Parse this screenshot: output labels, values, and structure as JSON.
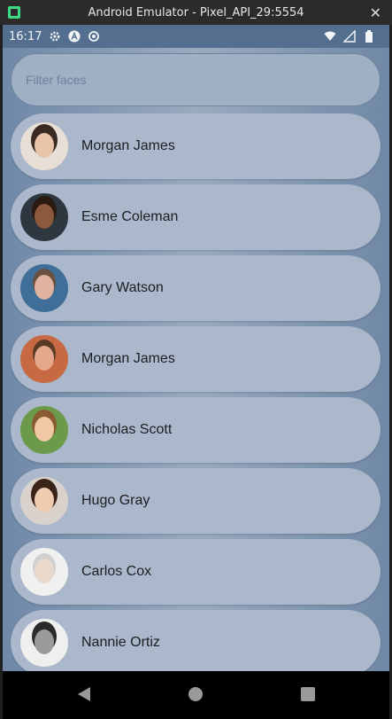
{
  "window": {
    "title": "Android Emulator - Pixel_API_29:5554",
    "close_label": "✕"
  },
  "statusbar": {
    "time": "16:17",
    "icons": [
      "gear-icon",
      "a-circle-icon",
      "sync-icon"
    ],
    "right_icons": [
      "wifi-icon",
      "signal-icon",
      "battery-icon"
    ]
  },
  "search": {
    "placeholder": "Filter faces"
  },
  "faces": [
    {
      "name": "Morgan James",
      "avatar_bg": "#e7dfd6",
      "face_color": "#e9c2aa",
      "hair_color": "#3a2a22"
    },
    {
      "name": "Esme Coleman",
      "avatar_bg": "#2e3640",
      "face_color": "#8b5a3c",
      "hair_color": "#2a1a12"
    },
    {
      "name": "Gary Watson",
      "avatar_bg": "#3f6f98",
      "face_color": "#e0b3a0",
      "hair_color": "#6a5040"
    },
    {
      "name": "Morgan James",
      "avatar_bg": "#c76a44",
      "face_color": "#e4a98a",
      "hair_color": "#5a3a22"
    },
    {
      "name": "Nicholas Scott",
      "avatar_bg": "#6a9a4a",
      "face_color": "#f0c8a6",
      "hair_color": "#8a5a30"
    },
    {
      "name": "Hugo Gray",
      "avatar_bg": "#d9d2cc",
      "face_color": "#efcbb2",
      "hair_color": "#3a2418"
    },
    {
      "name": "Carlos Cox",
      "avatar_bg": "#f0f0f0",
      "face_color": "#e9d8cc",
      "hair_color": "#cfcfcf"
    },
    {
      "name": "Nannie Ortiz",
      "avatar_bg": "#efefef",
      "face_color": "#9a9a9a",
      "hair_color": "#2a2a2a"
    }
  ],
  "navbar": {
    "buttons": [
      "back",
      "home",
      "recents"
    ]
  }
}
